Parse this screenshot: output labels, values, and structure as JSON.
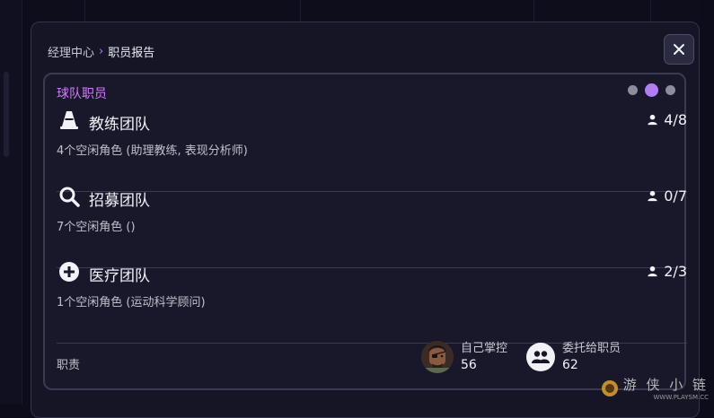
{
  "breadcrumb": {
    "parent": "经理中心",
    "separator": "›",
    "current": "职员报告"
  },
  "panel": {
    "title": "球队职员",
    "pager": {
      "pages": 3,
      "active": 2
    },
    "teams": [
      {
        "icon": "cone-icon",
        "name": "教练团队",
        "count": "4/8",
        "desc": "4个空闲角色 (助理教练, 表现分析师)"
      },
      {
        "icon": "magnifier-icon",
        "name": "招募团队",
        "count": "0/7",
        "desc": "7个空闲角色 ()"
      },
      {
        "icon": "medical-cross-icon",
        "name": "医疗团队",
        "count": "2/3",
        "desc": "1个空闲角色 (运动科学顾问)"
      }
    ],
    "footer": {
      "label": "职责",
      "self": {
        "label": "自己掌控",
        "value": "56"
      },
      "delegated": {
        "label": "委托给职员",
        "value": "62"
      }
    }
  },
  "watermark": {
    "text": "游 侠 小 链",
    "url": "WWW.PLAYSM.CC"
  },
  "colors": {
    "accent": "#b27cf7",
    "title": "#d37bff",
    "panel_bg": "#18182a",
    "modal_bg": "#151526"
  }
}
